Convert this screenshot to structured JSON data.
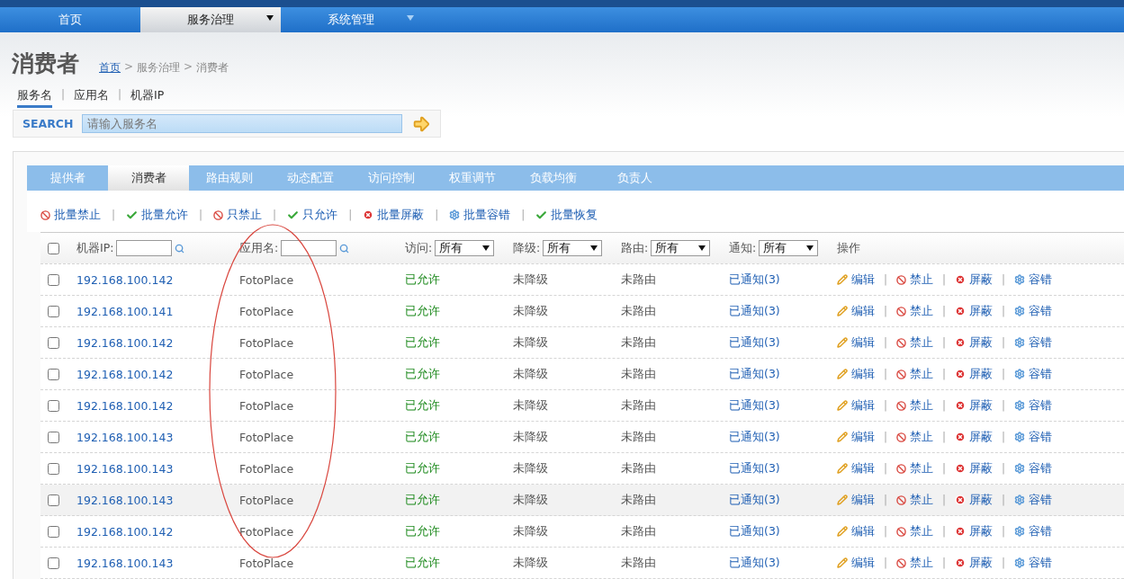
{
  "nav": [
    {
      "label": "首页",
      "selected": false,
      "has_menu": false
    },
    {
      "label": "服务治理",
      "selected": true,
      "has_menu": true
    },
    {
      "label": "系统管理",
      "selected": false,
      "has_menu": true
    }
  ],
  "page_title": "消费者",
  "breadcrumb": [
    {
      "label": "首页",
      "kind": "link"
    },
    {
      "label": ">",
      "kind": "separator"
    },
    {
      "label": "服务治理",
      "kind": "text"
    },
    {
      "label": ">",
      "kind": "separator"
    },
    {
      "label": "消费者",
      "kind": "text"
    }
  ],
  "search_tabs": [
    {
      "label": "服务名",
      "kind": "tab",
      "selected": true
    },
    {
      "label": "|",
      "kind": "separator"
    },
    {
      "label": "应用名",
      "kind": "tab",
      "selected": false
    },
    {
      "label": "|",
      "kind": "separator"
    },
    {
      "label": "机器IP",
      "kind": "tab",
      "selected": false
    }
  ],
  "search": {
    "label": "SEARCH",
    "placeholder": "请输入服务名"
  },
  "tabs": [
    {
      "label": "提供者",
      "selected": false
    },
    {
      "label": "消费者",
      "selected": true
    },
    {
      "label": "路由规则",
      "selected": false
    },
    {
      "label": "动态配置",
      "selected": false
    },
    {
      "label": "访问控制",
      "selected": false
    },
    {
      "label": "权重调节",
      "selected": false
    },
    {
      "label": "负载均衡",
      "selected": false
    },
    {
      "label": "负责人",
      "selected": false
    }
  ],
  "batch_actions": [
    {
      "label": "批量禁止",
      "kind": "ban"
    },
    {
      "label": "|",
      "kind": "separator"
    },
    {
      "label": "批量允许",
      "kind": "check"
    },
    {
      "label": "|",
      "kind": "separator"
    },
    {
      "label": "只禁止",
      "kind": "ban"
    },
    {
      "label": "|",
      "kind": "separator"
    },
    {
      "label": "只允许",
      "kind": "check"
    },
    {
      "label": "|",
      "kind": "separator"
    },
    {
      "label": "批量屏蔽",
      "kind": "block"
    },
    {
      "label": "|",
      "kind": "separator"
    },
    {
      "label": "批量容错",
      "kind": "tolerate"
    },
    {
      "label": "|",
      "kind": "separator"
    },
    {
      "label": "批量恢复",
      "kind": "check"
    }
  ],
  "table": {
    "select_all_checked": false,
    "filters": [
      {
        "label": "机器IP:",
        "kind": "text"
      },
      {
        "label": "应用名:",
        "kind": "text"
      },
      {
        "label": "访问:",
        "kind": "select",
        "value": "所有"
      },
      {
        "label": "降级:",
        "kind": "select",
        "value": "所有"
      },
      {
        "label": "路由:",
        "kind": "select",
        "value": "所有"
      },
      {
        "label": "通知:",
        "kind": "select",
        "value": "所有"
      },
      {
        "label": "操作",
        "kind": "plain"
      }
    ],
    "rows": [
      {
        "checked": false,
        "ip": "192.168.100.142",
        "app": "FotoPlace",
        "access": "已允许",
        "degrade": "未降级",
        "route": "未路由",
        "notify": "已通知(3)",
        "highlighted": false,
        "actions": [
          {
            "label": "编辑",
            "kind": "edit"
          },
          {
            "label": "|",
            "kind": "separator"
          },
          {
            "label": "禁止",
            "kind": "ban"
          },
          {
            "label": "|",
            "kind": "separator"
          },
          {
            "label": "屏蔽",
            "kind": "block"
          },
          {
            "label": "|",
            "kind": "separator"
          },
          {
            "label": "容错",
            "kind": "tolerate"
          }
        ]
      },
      {
        "checked": false,
        "ip": "192.168.100.141",
        "app": "FotoPlace",
        "access": "已允许",
        "degrade": "未降级",
        "route": "未路由",
        "notify": "已通知(3)",
        "highlighted": false,
        "actions": [
          {
            "label": "编辑",
            "kind": "edit"
          },
          {
            "label": "|",
            "kind": "separator"
          },
          {
            "label": "禁止",
            "kind": "ban"
          },
          {
            "label": "|",
            "kind": "separator"
          },
          {
            "label": "屏蔽",
            "kind": "block"
          },
          {
            "label": "|",
            "kind": "separator"
          },
          {
            "label": "容错",
            "kind": "tolerate"
          }
        ]
      },
      {
        "checked": false,
        "ip": "192.168.100.142",
        "app": "FotoPlace",
        "access": "已允许",
        "degrade": "未降级",
        "route": "未路由",
        "notify": "已通知(3)",
        "highlighted": false,
        "actions": [
          {
            "label": "编辑",
            "kind": "edit"
          },
          {
            "label": "|",
            "kind": "separator"
          },
          {
            "label": "禁止",
            "kind": "ban"
          },
          {
            "label": "|",
            "kind": "separator"
          },
          {
            "label": "屏蔽",
            "kind": "block"
          },
          {
            "label": "|",
            "kind": "separator"
          },
          {
            "label": "容错",
            "kind": "tolerate"
          }
        ]
      },
      {
        "checked": false,
        "ip": "192.168.100.142",
        "app": "FotoPlace",
        "access": "已允许",
        "degrade": "未降级",
        "route": "未路由",
        "notify": "已通知(3)",
        "highlighted": false,
        "actions": [
          {
            "label": "编辑",
            "kind": "edit"
          },
          {
            "label": "|",
            "kind": "separator"
          },
          {
            "label": "禁止",
            "kind": "ban"
          },
          {
            "label": "|",
            "kind": "separator"
          },
          {
            "label": "屏蔽",
            "kind": "block"
          },
          {
            "label": "|",
            "kind": "separator"
          },
          {
            "label": "容错",
            "kind": "tolerate"
          }
        ]
      },
      {
        "checked": false,
        "ip": "192.168.100.142",
        "app": "FotoPlace",
        "access": "已允许",
        "degrade": "未降级",
        "route": "未路由",
        "notify": "已通知(3)",
        "highlighted": false,
        "actions": [
          {
            "label": "编辑",
            "kind": "edit"
          },
          {
            "label": "|",
            "kind": "separator"
          },
          {
            "label": "禁止",
            "kind": "ban"
          },
          {
            "label": "|",
            "kind": "separator"
          },
          {
            "label": "屏蔽",
            "kind": "block"
          },
          {
            "label": "|",
            "kind": "separator"
          },
          {
            "label": "容错",
            "kind": "tolerate"
          }
        ]
      },
      {
        "checked": false,
        "ip": "192.168.100.143",
        "app": "FotoPlace",
        "access": "已允许",
        "degrade": "未降级",
        "route": "未路由",
        "notify": "已通知(3)",
        "highlighted": false,
        "actions": [
          {
            "label": "编辑",
            "kind": "edit"
          },
          {
            "label": "|",
            "kind": "separator"
          },
          {
            "label": "禁止",
            "kind": "ban"
          },
          {
            "label": "|",
            "kind": "separator"
          },
          {
            "label": "屏蔽",
            "kind": "block"
          },
          {
            "label": "|",
            "kind": "separator"
          },
          {
            "label": "容错",
            "kind": "tolerate"
          }
        ]
      },
      {
        "checked": false,
        "ip": "192.168.100.143",
        "app": "FotoPlace",
        "access": "已允许",
        "degrade": "未降级",
        "route": "未路由",
        "notify": "已通知(3)",
        "highlighted": false,
        "actions": [
          {
            "label": "编辑",
            "kind": "edit"
          },
          {
            "label": "|",
            "kind": "separator"
          },
          {
            "label": "禁止",
            "kind": "ban"
          },
          {
            "label": "|",
            "kind": "separator"
          },
          {
            "label": "屏蔽",
            "kind": "block"
          },
          {
            "label": "|",
            "kind": "separator"
          },
          {
            "label": "容错",
            "kind": "tolerate"
          }
        ]
      },
      {
        "checked": false,
        "ip": "192.168.100.143",
        "app": "FotoPlace",
        "access": "已允许",
        "degrade": "未降级",
        "route": "未路由",
        "notify": "已通知(3)",
        "highlighted": true,
        "actions": [
          {
            "label": "编辑",
            "kind": "edit"
          },
          {
            "label": "|",
            "kind": "separator"
          },
          {
            "label": "禁止",
            "kind": "ban"
          },
          {
            "label": "|",
            "kind": "separator"
          },
          {
            "label": "屏蔽",
            "kind": "block"
          },
          {
            "label": "|",
            "kind": "separator"
          },
          {
            "label": "容错",
            "kind": "tolerate"
          }
        ]
      },
      {
        "checked": false,
        "ip": "192.168.100.142",
        "app": "FotoPlace",
        "access": "已允许",
        "degrade": "未降级",
        "route": "未路由",
        "notify": "已通知(3)",
        "highlighted": false,
        "actions": [
          {
            "label": "编辑",
            "kind": "edit"
          },
          {
            "label": "|",
            "kind": "separator"
          },
          {
            "label": "禁止",
            "kind": "ban"
          },
          {
            "label": "|",
            "kind": "separator"
          },
          {
            "label": "屏蔽",
            "kind": "block"
          },
          {
            "label": "|",
            "kind": "separator"
          },
          {
            "label": "容错",
            "kind": "tolerate"
          }
        ]
      },
      {
        "checked": false,
        "ip": "192.168.100.143",
        "app": "FotoPlace",
        "access": "已允许",
        "degrade": "未降级",
        "route": "未路由",
        "notify": "已通知(3)",
        "highlighted": false,
        "actions": [
          {
            "label": "编辑",
            "kind": "edit"
          },
          {
            "label": "|",
            "kind": "separator"
          },
          {
            "label": "禁止",
            "kind": "ban"
          },
          {
            "label": "|",
            "kind": "separator"
          },
          {
            "label": "屏蔽",
            "kind": "block"
          },
          {
            "label": "|",
            "kind": "separator"
          },
          {
            "label": "容错",
            "kind": "tolerate"
          }
        ]
      }
    ]
  },
  "annotations": [
    {
      "kind": "ellipse",
      "color": "#d9473f"
    }
  ]
}
